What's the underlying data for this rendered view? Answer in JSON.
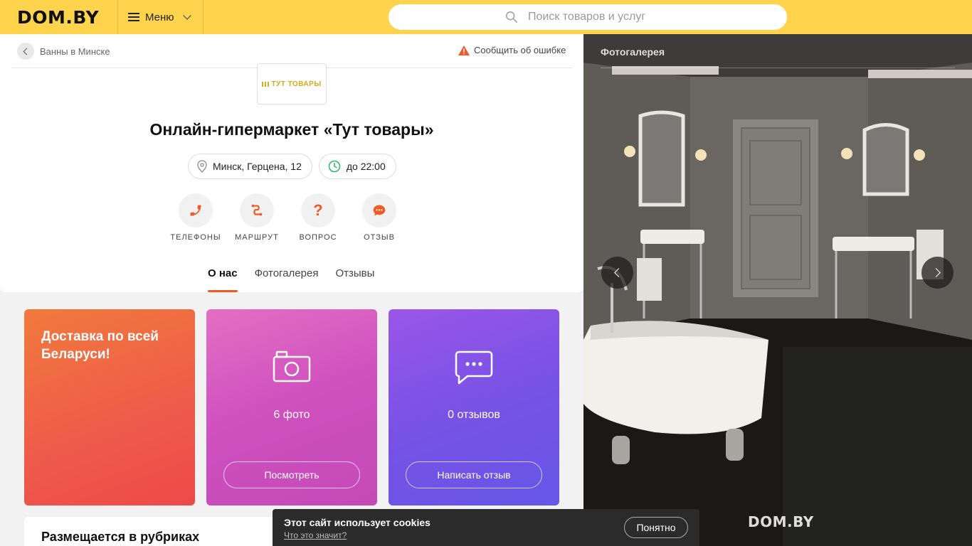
{
  "header": {
    "logo": "DOM.BY",
    "menu_label": "Меню",
    "search_placeholder": "Поиск товаров и услуг"
  },
  "breadcrumb": {
    "back_label": "Ванны в Минске"
  },
  "report_label": "Сообщить об ошибке",
  "shop": {
    "logo_text": "ТУТ ТОВАРЫ",
    "title": "Онлайн-гипермаркет «Тут товары»",
    "address": "Минск, Герцена, 12",
    "hours": "до 22:00"
  },
  "actions": [
    {
      "label": "ТЕЛЕФОНЫ",
      "icon": "phone-icon"
    },
    {
      "label": "МАРШРУТ",
      "icon": "route-icon"
    },
    {
      "label": "ВОПРОС",
      "icon": "question-icon"
    },
    {
      "label": "ОТЗЫВ",
      "icon": "chat-icon"
    }
  ],
  "tabs": [
    {
      "label": "О нас",
      "active": true
    },
    {
      "label": "Фотогалерея",
      "active": false
    },
    {
      "label": "Отзывы",
      "active": false
    }
  ],
  "tiles": {
    "delivery": {
      "text": "Доставка по всей Беларуси!"
    },
    "photos": {
      "count": "6 фото",
      "button": "Посмотреть",
      "icon": "camera-icon"
    },
    "reviews": {
      "count": "0 отзывов",
      "button": "Написать отзыв",
      "icon": "chat-bubble-icon"
    }
  },
  "rubrics_title": "Размещается в рубриках",
  "gallery": {
    "title": "Фотогалерея",
    "watermark": "DOM.BY"
  },
  "cookie": {
    "message": "Этот сайт использует cookies",
    "link": "Что это значит?",
    "button": "Понятно"
  },
  "colors": {
    "brand_yellow": "#ffd44c",
    "accent_orange": "#f15a24",
    "tile_orange": "#ef5a4a",
    "tile_pink": "#cf4fbf",
    "tile_purple": "#7752e5"
  }
}
